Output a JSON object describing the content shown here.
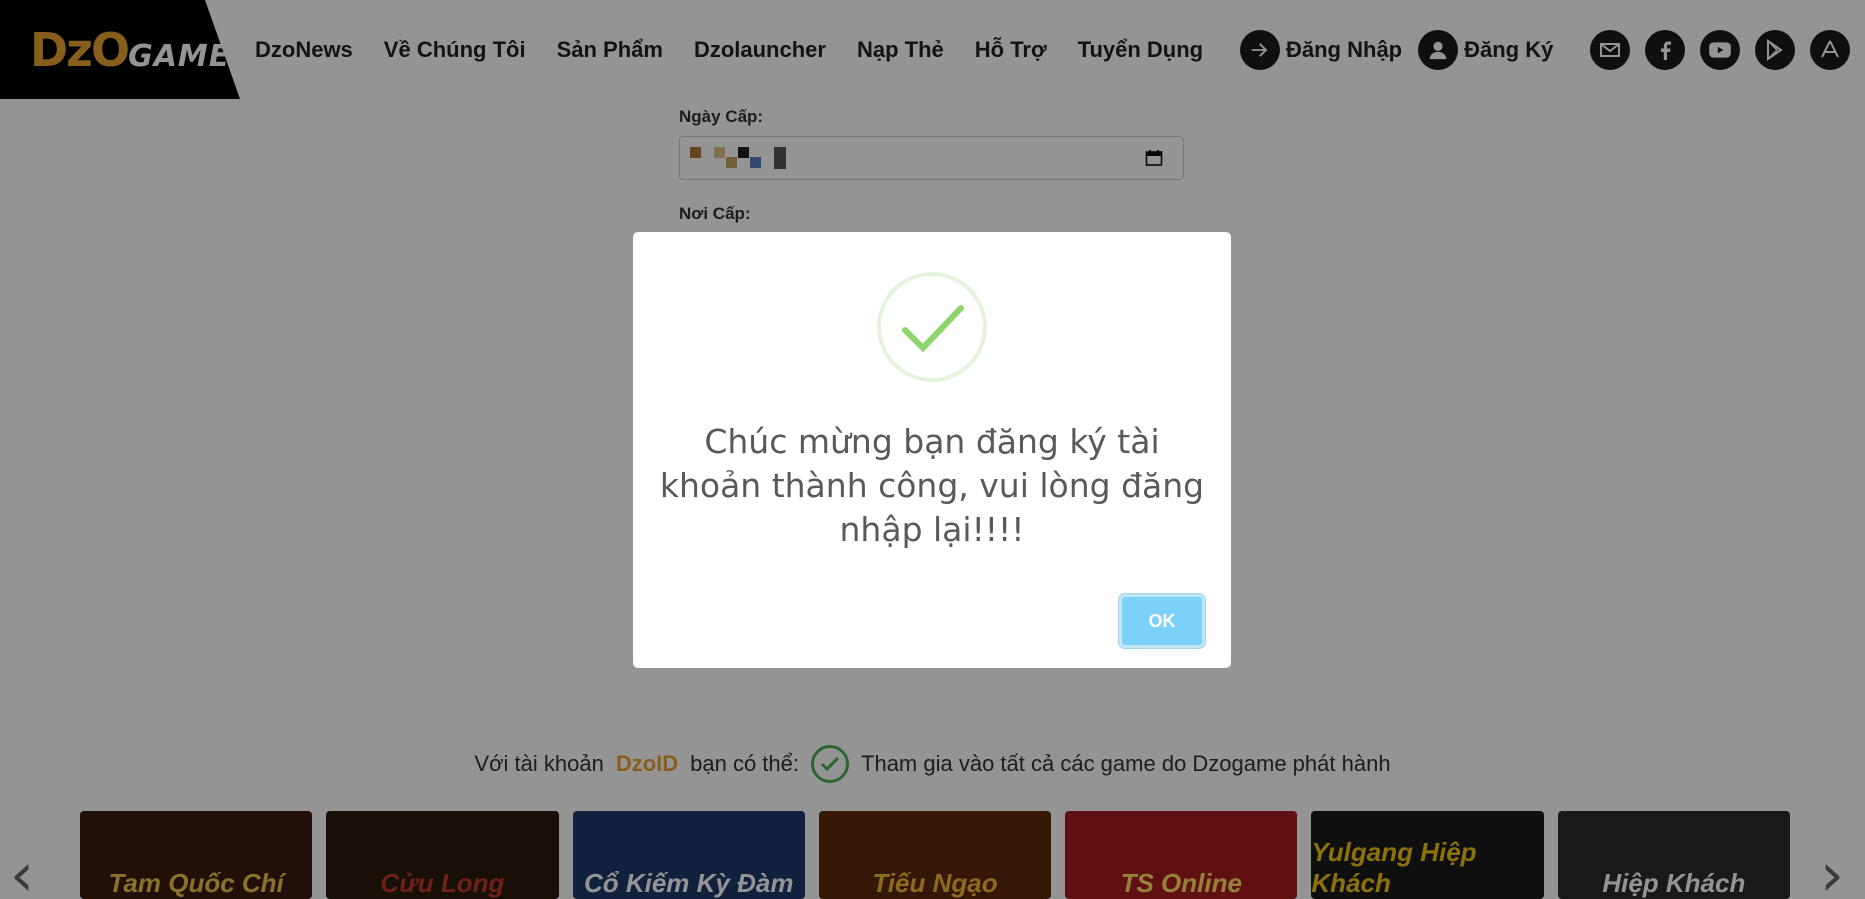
{
  "header": {
    "logo_text": "DzoGame",
    "nav": [
      "DzoNews",
      "Về Chúng Tôi",
      "Sản Phẩm",
      "Dzolauncher",
      "Nạp Thẻ",
      "Hỗ Trợ",
      "Tuyển Dụng"
    ],
    "login_label": "Đăng Nhập",
    "register_label": "Đăng Ký",
    "social_icons": [
      "mail-icon",
      "facebook-icon",
      "youtube-icon",
      "google-play-icon",
      "app-store-icon"
    ]
  },
  "form": {
    "issue_date_label": "Ngày Cấp:",
    "issue_place_label": "Nơi Cấp:"
  },
  "modal": {
    "icon": "success-check-icon",
    "message": "Chúc mừng bạn đăng ký tài khoản thành công, vui lòng đăng nhập lại!!!!",
    "ok_label": "OK"
  },
  "footer": {
    "tagline_prefix": "Với tài khoản",
    "tagline_brand": "DzoID",
    "tagline_middle": "bạn có thể:",
    "tagline_benefit": "Tham gia vào tất cả các game do Dzogame phát hành",
    "games": [
      "Tam Quốc Chí",
      "Cửu Long",
      "Cổ Kiếm Kỳ Đàm",
      "Tiếu Ngạo",
      "TS Online",
      "Yulgang Hiệp Khách",
      "Hiệp Khách"
    ]
  },
  "colors": {
    "brand_orange": "#e8a330",
    "ok_button": "#7cd1f9",
    "success_green": "#8cd46b"
  }
}
